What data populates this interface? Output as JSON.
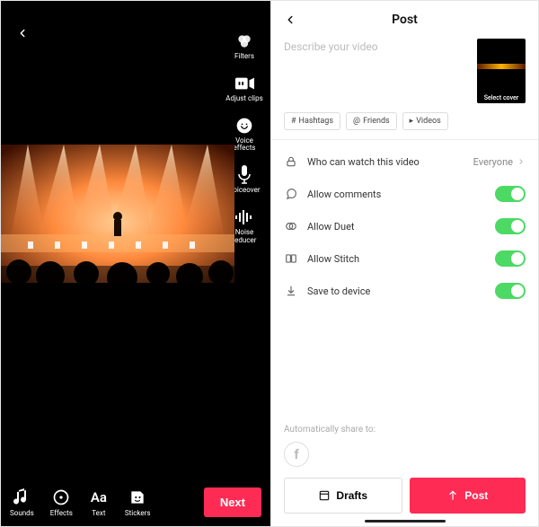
{
  "left": {
    "side_tools": {
      "filters": "Filters",
      "adjust_clips": "Adjust clips",
      "voice_effects": "Voice\neffects",
      "voiceover": "Voiceover",
      "noise_reducer": "Noise\nreducer"
    },
    "bottom_tools": {
      "sounds": "Sounds",
      "effects": "Effects",
      "text": "Text",
      "stickers": "Stickers"
    },
    "next": "Next"
  },
  "right": {
    "title": "Post",
    "describe_placeholder": "Describe your video",
    "cover_label": "Select cover",
    "chips": {
      "hashtags": "Hashtags",
      "friends": "Friends",
      "videos": "Videos"
    },
    "settings": {
      "who": "Who can watch this video",
      "who_value": "Everyone",
      "comments": "Allow comments",
      "duet": "Allow Duet",
      "stitch": "Allow Stitch",
      "save": "Save to device"
    },
    "share_label": "Automatically share to:",
    "drafts": "Drafts",
    "post": "Post"
  }
}
